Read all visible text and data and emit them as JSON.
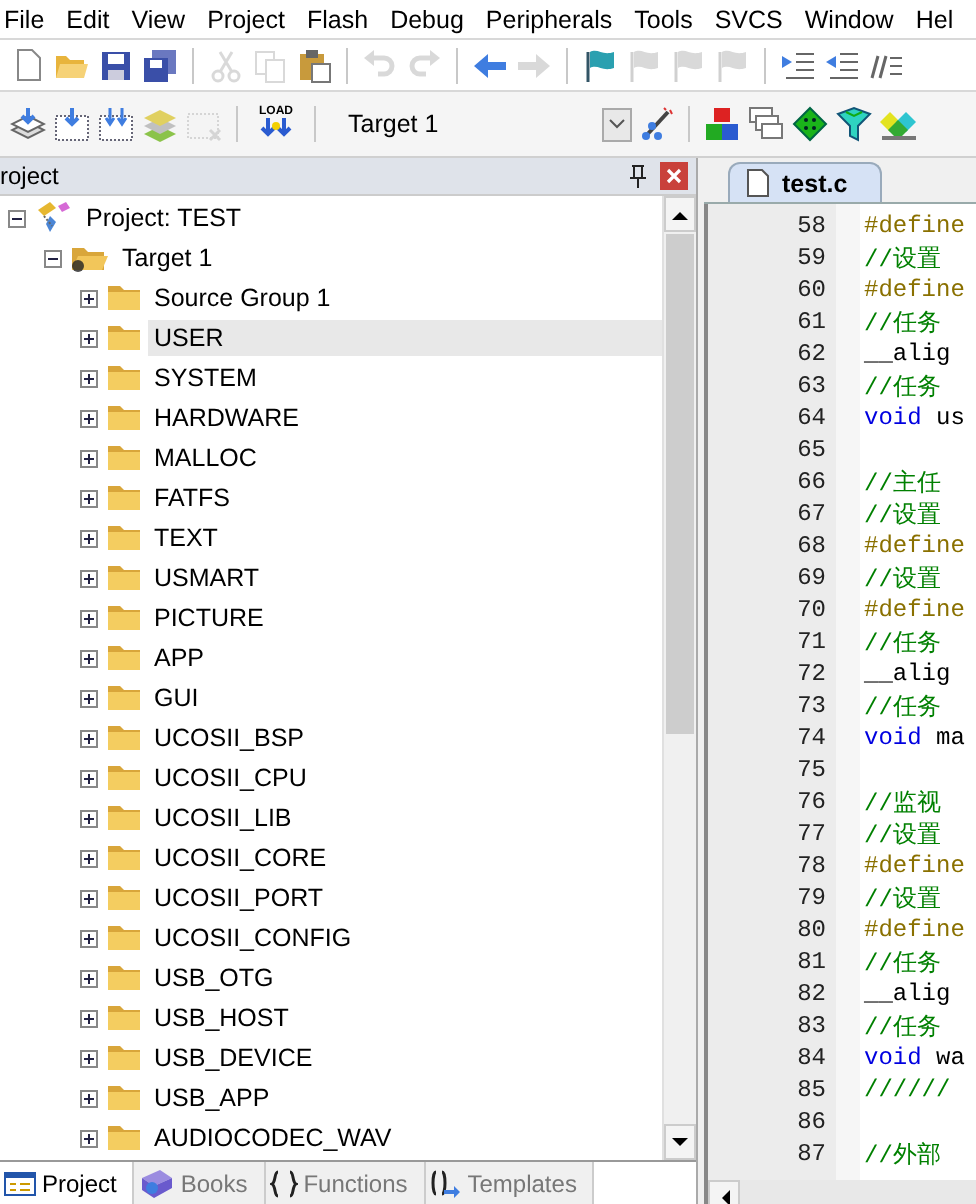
{
  "menu": [
    "File",
    "Edit",
    "View",
    "Project",
    "Flash",
    "Debug",
    "Peripherals",
    "Tools",
    "SVCS",
    "Window",
    "Hel"
  ],
  "toolbar": [
    [
      {
        "kind": "new",
        "disabled": false
      },
      {
        "kind": "open",
        "disabled": false
      },
      {
        "kind": "save",
        "disabled": false
      },
      {
        "kind": "save_all",
        "disabled": false
      }
    ],
    [
      {
        "kind": "cut",
        "disabled": true
      },
      {
        "kind": "copy",
        "disabled": true
      },
      {
        "kind": "paste",
        "disabled": false
      }
    ],
    [
      {
        "kind": "undo",
        "disabled": true
      },
      {
        "kind": "redo",
        "disabled": true
      }
    ],
    [
      {
        "kind": "back",
        "disabled": false
      },
      {
        "kind": "forward",
        "disabled": true
      }
    ],
    [
      {
        "kind": "flag",
        "disabled": false
      },
      {
        "kind": "flag",
        "disabled": true
      },
      {
        "kind": "flag",
        "disabled": true
      },
      {
        "kind": "flag",
        "disabled": true
      }
    ],
    [
      {
        "kind": "indent",
        "disabled": false
      },
      {
        "kind": "outdent",
        "disabled": false
      },
      {
        "kind": "comment",
        "disabled": false
      }
    ]
  ],
  "build_toolbar": {
    "left": [
      {
        "kind": "layers",
        "disabled": false
      },
      {
        "kind": "grid",
        "disabled": false
      },
      {
        "kind": "grid2",
        "disabled": false
      },
      {
        "kind": "stack",
        "disabled": false
      },
      {
        "kind": "grid_x",
        "disabled": true
      }
    ],
    "load_label": "LOAD",
    "target": "Target 1",
    "right": [
      {
        "kind": "wand",
        "disabled": false
      },
      {
        "kind": "blocks",
        "disabled": false
      },
      {
        "kind": "windows",
        "disabled": false
      },
      {
        "kind": "diamond",
        "disabled": false
      },
      {
        "kind": "funnel",
        "disabled": false
      },
      {
        "kind": "diamonds",
        "disabled": false
      }
    ]
  },
  "project_panel": {
    "title": "roject",
    "tree": [
      {
        "label": "Project: TEST",
        "kind": "project",
        "expanded": true,
        "selected": false,
        "children": [
          {
            "label": "Target 1",
            "kind": "target",
            "expanded": true,
            "selected": false,
            "children": [
              {
                "label": "Source Group 1",
                "kind": "group",
                "expanded": false,
                "selected": false
              },
              {
                "label": "USER",
                "kind": "group",
                "expanded": false,
                "selected": true
              },
              {
                "label": "SYSTEM",
                "kind": "group",
                "expanded": false,
                "selected": false
              },
              {
                "label": "HARDWARE",
                "kind": "group",
                "expanded": false,
                "selected": false
              },
              {
                "label": "MALLOC",
                "kind": "group",
                "expanded": false,
                "selected": false
              },
              {
                "label": "FATFS",
                "kind": "group",
                "expanded": false,
                "selected": false
              },
              {
                "label": "TEXT",
                "kind": "group",
                "expanded": false,
                "selected": false
              },
              {
                "label": "USMART",
                "kind": "group",
                "expanded": false,
                "selected": false
              },
              {
                "label": "PICTURE",
                "kind": "group",
                "expanded": false,
                "selected": false
              },
              {
                "label": "APP",
                "kind": "group",
                "expanded": false,
                "selected": false
              },
              {
                "label": "GUI",
                "kind": "group",
                "expanded": false,
                "selected": false
              },
              {
                "label": "UCOSII_BSP",
                "kind": "group",
                "expanded": false,
                "selected": false
              },
              {
                "label": "UCOSII_CPU",
                "kind": "group",
                "expanded": false,
                "selected": false
              },
              {
                "label": "UCOSII_LIB",
                "kind": "group",
                "expanded": false,
                "selected": false
              },
              {
                "label": "UCOSII_CORE",
                "kind": "group",
                "expanded": false,
                "selected": false
              },
              {
                "label": "UCOSII_PORT",
                "kind": "group",
                "expanded": false,
                "selected": false
              },
              {
                "label": "UCOSII_CONFIG",
                "kind": "group",
                "expanded": false,
                "selected": false
              },
              {
                "label": "USB_OTG",
                "kind": "group",
                "expanded": false,
                "selected": false
              },
              {
                "label": "USB_HOST",
                "kind": "group",
                "expanded": false,
                "selected": false
              },
              {
                "label": "USB_DEVICE",
                "kind": "group",
                "expanded": false,
                "selected": false
              },
              {
                "label": "USB_APP",
                "kind": "group",
                "expanded": false,
                "selected": false
              },
              {
                "label": "AUDIOCODEC_WAV",
                "kind": "group",
                "expanded": false,
                "selected": false
              }
            ]
          }
        ]
      }
    ],
    "tabs": [
      {
        "label": "Project",
        "kind": "project",
        "selected": true
      },
      {
        "label": "Books",
        "kind": "books",
        "selected": false
      },
      {
        "label": "Functions",
        "kind": "functions",
        "selected": false
      },
      {
        "label": "Templates",
        "kind": "templates",
        "selected": false
      }
    ]
  },
  "editor": {
    "tabs": [
      {
        "label": "test.c",
        "selected": true
      }
    ],
    "lines": [
      {
        "num": "58",
        "tokens": [
          {
            "kind": "directive",
            "text": "#define"
          }
        ]
      },
      {
        "num": "59",
        "tokens": [
          {
            "kind": "comment",
            "text": "//设置"
          }
        ]
      },
      {
        "num": "60",
        "tokens": [
          {
            "kind": "directive",
            "text": "#define"
          }
        ]
      },
      {
        "num": "61",
        "tokens": [
          {
            "kind": "comment",
            "text": "//任务"
          }
        ]
      },
      {
        "num": "62",
        "tokens": [
          {
            "kind": "plain",
            "text": "__alig"
          }
        ]
      },
      {
        "num": "63",
        "tokens": [
          {
            "kind": "comment",
            "text": "//任务"
          }
        ]
      },
      {
        "num": "64",
        "tokens": [
          {
            "kind": "keyword",
            "text": "void"
          },
          {
            "kind": "plain",
            "text": " us"
          }
        ]
      },
      {
        "num": "65"
      },
      {
        "num": "66",
        "tokens": [
          {
            "kind": "comment",
            "text": "//主任"
          }
        ]
      },
      {
        "num": "67",
        "tokens": [
          {
            "kind": "comment",
            "text": "//设置"
          }
        ]
      },
      {
        "num": "68",
        "tokens": [
          {
            "kind": "directive",
            "text": "#define"
          }
        ]
      },
      {
        "num": "69",
        "tokens": [
          {
            "kind": "comment",
            "text": "//设置"
          }
        ]
      },
      {
        "num": "70",
        "tokens": [
          {
            "kind": "directive",
            "text": "#define"
          }
        ]
      },
      {
        "num": "71",
        "tokens": [
          {
            "kind": "comment",
            "text": "//任务"
          }
        ]
      },
      {
        "num": "72",
        "tokens": [
          {
            "kind": "plain",
            "text": "__alig"
          }
        ]
      },
      {
        "num": "73",
        "tokens": [
          {
            "kind": "comment",
            "text": "//任务"
          }
        ]
      },
      {
        "num": "74",
        "tokens": [
          {
            "kind": "keyword",
            "text": "void"
          },
          {
            "kind": "plain",
            "text": " ma"
          }
        ]
      },
      {
        "num": "75"
      },
      {
        "num": "76",
        "tokens": [
          {
            "kind": "comment",
            "text": "//监视"
          }
        ]
      },
      {
        "num": "77",
        "tokens": [
          {
            "kind": "comment",
            "text": "//设置"
          }
        ]
      },
      {
        "num": "78",
        "tokens": [
          {
            "kind": "directive",
            "text": "#define"
          }
        ]
      },
      {
        "num": "79",
        "tokens": [
          {
            "kind": "comment",
            "text": "//设置"
          }
        ]
      },
      {
        "num": "80",
        "tokens": [
          {
            "kind": "directive",
            "text": "#define"
          }
        ]
      },
      {
        "num": "81",
        "tokens": [
          {
            "kind": "comment",
            "text": "//任务"
          }
        ]
      },
      {
        "num": "82",
        "tokens": [
          {
            "kind": "plain",
            "text": "__alig"
          }
        ]
      },
      {
        "num": "83",
        "tokens": [
          {
            "kind": "comment",
            "text": "//任务"
          }
        ]
      },
      {
        "num": "84",
        "tokens": [
          {
            "kind": "keyword",
            "text": "void"
          },
          {
            "kind": "plain",
            "text": " wa"
          }
        ]
      },
      {
        "num": "85",
        "tokens": [
          {
            "kind": "comment",
            "text": "//////"
          }
        ]
      },
      {
        "num": "86"
      },
      {
        "num": "87",
        "tokens": [
          {
            "kind": "comment",
            "text": "//外部"
          }
        ]
      }
    ]
  }
}
